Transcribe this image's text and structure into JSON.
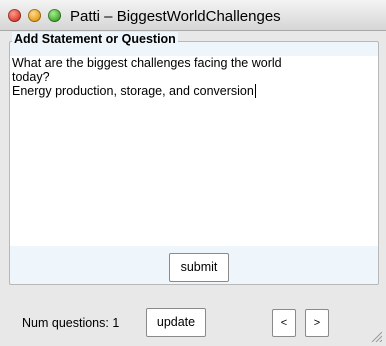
{
  "window": {
    "title": "Patti – BiggestWorldChallenges"
  },
  "form": {
    "group_label": "Add Statement or Question",
    "text_lines": [
      "What are the biggest challenges facing the world",
      "today?",
      "Energy production, storage, and conversion"
    ],
    "submit_label": "submit"
  },
  "footer": {
    "count_label": "Num questions: 1",
    "update_label": "update",
    "prev_label": "<",
    "next_label": ">"
  },
  "colors": {
    "group_background": "#eef6fb",
    "window_background": "#e8e8e8"
  },
  "icons": {
    "close": "close-icon",
    "minimize": "minimize-icon",
    "maximize": "maximize-icon",
    "resize": "resize-grip-icon"
  }
}
